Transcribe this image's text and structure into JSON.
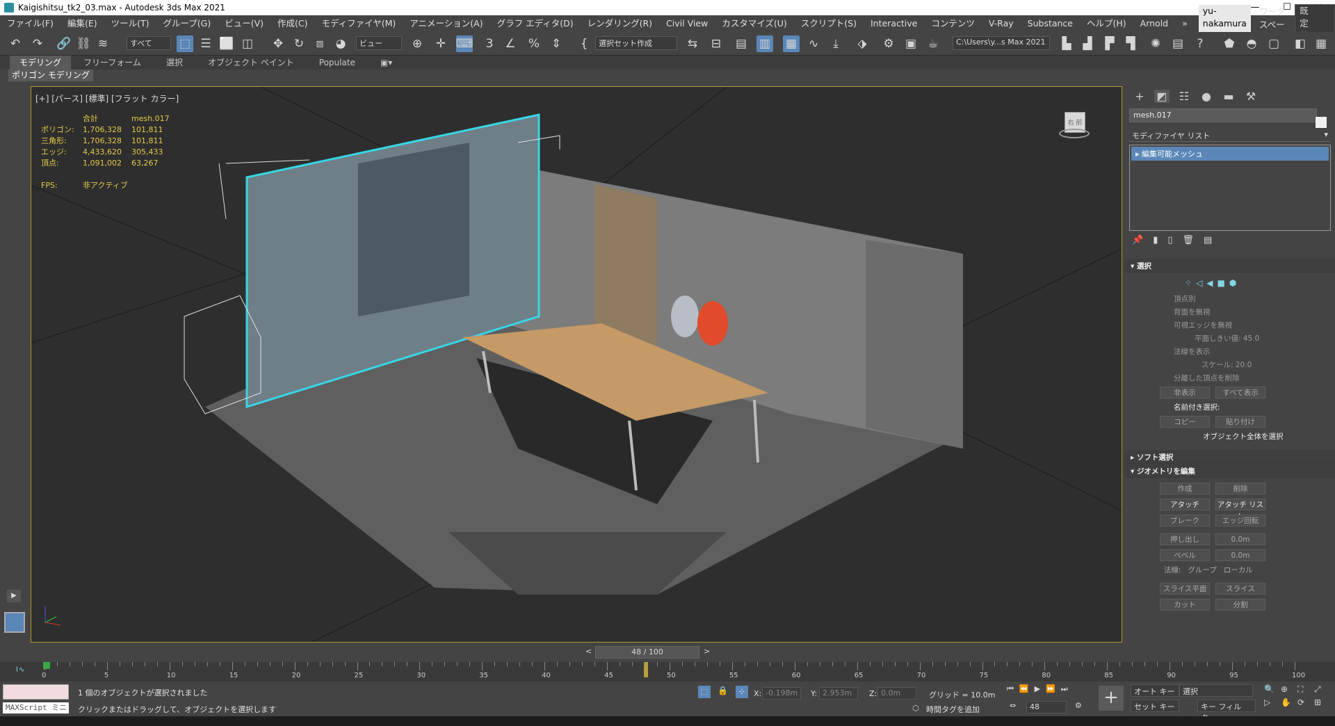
{
  "window": {
    "title": "Kaigishitsu_tk2_03.max - Autodesk 3ds Max 2021",
    "min": "—",
    "max": "☐",
    "close": "✕"
  },
  "menu": [
    "ファイル(F)",
    "編集(E)",
    "ツール(T)",
    "グループ(G)",
    "ビュー(V)",
    "作成(C)",
    "モディファイヤ(M)",
    "アニメーション(A)",
    "グラフ エディタ(D)",
    "レンダリング(R)",
    "Civil View",
    "カスタマイズ(U)",
    "スクリプト(S)",
    "Interactive",
    "コンテンツ",
    "V-Ray",
    "Substance",
    "ヘルプ(H)",
    "Arnold",
    "»"
  ],
  "user": "yu-nakamura ▾",
  "workspace_label": "ワークスペース:",
  "workspace_value": "既定値",
  "toolbar": {
    "filter": "すべて",
    "view": "ビュー",
    "selset": "選択セット作成",
    "path": "C:\\Users\\y...s Max 2021"
  },
  "ribbon_tabs": [
    "モデリング",
    "フリーフォーム",
    "選択",
    "オブジェクト ペイント",
    "Populate"
  ],
  "ribbon_sub": "ポリゴン モデリング",
  "viewport": {
    "label": "[+] [パース] [標準] [フラット カラー]",
    "stats_header": [
      "",
      "合計",
      "mesh.017"
    ],
    "stats": [
      [
        "ポリゴン:",
        "1,706,328",
        "101,811"
      ],
      [
        "三角形:",
        "1,706,328",
        "101,811"
      ],
      [
        "エッジ:",
        "4,433,620",
        "305,433"
      ],
      [
        "頂点:",
        "1,091,002",
        "63,267"
      ]
    ],
    "fps_label": "FPS:",
    "fps_value": "非アクティブ",
    "viewcube_label": "右 前"
  },
  "cmd": {
    "object_name": "mesh.017",
    "modifier_list": "モディファイヤ リスト",
    "stack_item": "編集可能メッシュ",
    "select_header": "選択",
    "opts": [
      "頂点別",
      "背面を無視",
      "可視エッジを無視",
      "平面しきい値: 45.0",
      "法線を表示",
      "スケール: 20.0",
      "分離した頂点を削除"
    ],
    "hide": "非表示",
    "show_all": "すべて表示",
    "named_sel": "名前付き選択:",
    "copy": "コピー",
    "paste": "貼り付け",
    "select_whole": "オブジェクト全体を選択",
    "soft_sel": "ソフト選択",
    "edit_geom": "ジオメトリを編集",
    "create": "作成",
    "delete": "削除",
    "attach": "アタッチ",
    "attach_list": "アタッチ リスト",
    "break": "ブレーク",
    "edge_turn": "エッジ回転",
    "extrude": "押し出し",
    "extrude_val": "0.0m",
    "bevel": "ベベル",
    "bevel_val": "0.0m",
    "normal": "法線:",
    "group": "グループ",
    "local": "ローカル",
    "slice_plane": "スライス平面",
    "slice": "スライス",
    "cut": "カット",
    "split": "分割"
  },
  "time": {
    "slider": "48 / 100",
    "current": "48"
  },
  "timeline_labels": [
    "0",
    "5",
    "10",
    "15",
    "20",
    "25",
    "30",
    "35",
    "40",
    "45",
    "50",
    "55",
    "60",
    "65",
    "70",
    "75",
    "80",
    "85",
    "90",
    "95",
    "100"
  ],
  "status": {
    "maxscript": "MAXScript ミニ",
    "msg1": "1 個のオブジェクトが選択されました",
    "msg2": "クリックまたはドラッグして、オブジェクトを選択します",
    "x_label": "X:",
    "x": "-0.198m",
    "y_label": "Y:",
    "y": "2.953m",
    "z_label": "Z:",
    "z": "0.0m",
    "grid": "グリッド = 10.0m",
    "addtag": "時間タグを追加",
    "autokey": "オート キー",
    "setkey": "セット キー",
    "sel_value": "選択",
    "keyfilter": "キー フィルタ..."
  }
}
